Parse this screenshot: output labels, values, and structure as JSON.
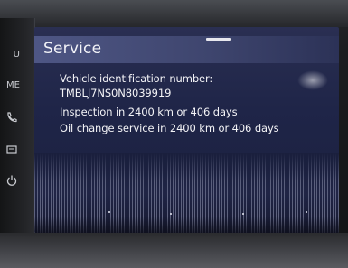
{
  "screen": {
    "title": "Service",
    "lines": {
      "vin_label": "Vehicle identification number:",
      "vin_value": "TMBLJ7NS0N8039919",
      "inspection": "Inspection in 2400 km or 406 days",
      "oil_change": "Oil change service in 2400 km or 406 days"
    }
  },
  "bezel": {
    "buttons": [
      {
        "label": "U",
        "icon": "nav-icon"
      },
      {
        "label": "ME",
        "icon": "menu-icon"
      },
      {
        "label": "",
        "icon": "phone-icon"
      },
      {
        "label": "",
        "icon": "media-icon"
      },
      {
        "label": "",
        "icon": "power-icon"
      }
    ]
  }
}
